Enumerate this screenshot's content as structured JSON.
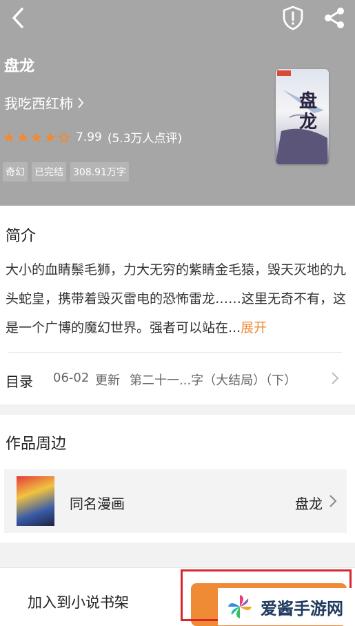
{
  "header": {
    "back_icon": "chevron-left-icon",
    "report_icon": "shield-exclamation-icon",
    "share_icon": "share-icon",
    "background": "#a6a6a6"
  },
  "book": {
    "title": "盘龙",
    "author": "我吃西红柿",
    "rating_stars": 4.5,
    "rating_score": "7.99",
    "rating_count": "(5.3万人点评)",
    "tags": [
      "奇幻",
      "已完结",
      "308.91万字"
    ],
    "cover_title": "盘龙"
  },
  "intro": {
    "heading": "简介",
    "text": "大小的血睛鬃毛狮，力大无穷的紫睛金毛猿，毁天灭地的九头蛇皇，携带着毁灭雷电的恐怖雷龙……这里无奇不有，这是一个广博的魔幻世界。强者可以站在...",
    "expand_label": "展开"
  },
  "toc": {
    "label": "目录",
    "date": "06-02",
    "update": "更新",
    "chapter": "第二十一...字（大结局）（下）"
  },
  "peripherals": {
    "heading": "作品周边",
    "item_name": "同名漫画",
    "item_value": "盘龙"
  },
  "bottom_bar": {
    "add_shelf_label": "加入到小说书架"
  },
  "watermark": {
    "text": "爱酱手游网"
  },
  "colors": {
    "accent": "#ef8a35",
    "highlight": "#d8262b"
  }
}
